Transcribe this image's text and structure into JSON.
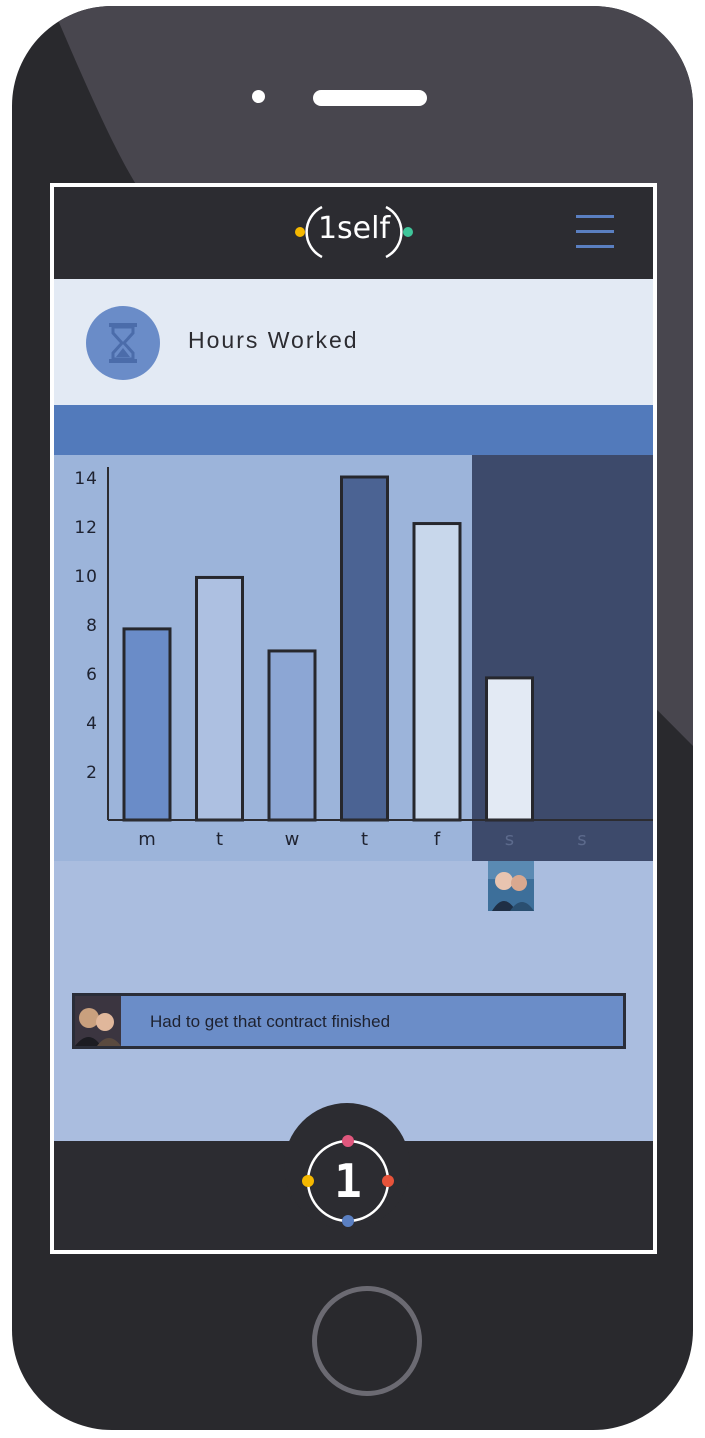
{
  "app": {
    "logo_text": "1self",
    "menu_icon": "hamburger-menu-icon"
  },
  "metric": {
    "title": "Hours Worked",
    "icon": "hourglass-icon"
  },
  "chart_data": {
    "type": "bar",
    "categories": [
      "m",
      "t",
      "w",
      "t",
      "f",
      "s",
      "s"
    ],
    "values": [
      7.8,
      9.9,
      6.9,
      14,
      12.1,
      5.8,
      null
    ],
    "ylim": [
      0,
      14
    ],
    "yticks": [
      "2",
      "4",
      "6",
      "8",
      "10",
      "12",
      "14"
    ],
    "colors": [
      "#6a8cc8",
      "#adc0e1",
      "#8ca6d4",
      "#4b6393",
      "#c8d7eb",
      "#e3eaf4",
      "#3d4a6b"
    ],
    "highlight_background": "#3d4a6b"
  },
  "note": {
    "text": "Had to get that contract finished"
  },
  "footer": {
    "logo_text": "1",
    "dot_colors": [
      "#e0577d",
      "#e7533a",
      "#5a7fc1",
      "#f5b800"
    ]
  }
}
